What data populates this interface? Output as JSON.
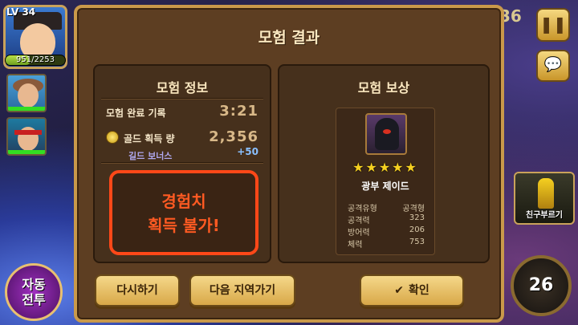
{
  "player": {
    "level": "LV 34",
    "hp_text": "951/2253",
    "hp_fraction": 0.42
  },
  "hud": {
    "auto_battle": "자동\n전투",
    "auto_battle_lines": [
      "자동",
      "전투"
    ],
    "pause_icon": "pause-icon",
    "chat_icon": "chat-icon",
    "friend_label": "친구부르기",
    "timer": "26",
    "top_counter": "36"
  },
  "dialog": {
    "title": "모험 결과",
    "info": {
      "title": "모험 정보",
      "record_label": "모험 완료 기록",
      "record_value": "3:21",
      "gold_label": "골드 획득 량",
      "gold_value": "2,356",
      "guild_label": "길드 보너스",
      "guild_value": "+50",
      "no_exp_lines": [
        "경험치",
        "획득 불가!"
      ]
    },
    "reward": {
      "title": "모험 보상",
      "stars": "★★★★★",
      "hero_name": "광부 제이드",
      "stats": [
        {
          "k": "공격유형",
          "v": "공격형"
        },
        {
          "k": "공격력",
          "v": "323"
        },
        {
          "k": "방어력",
          "v": "206"
        },
        {
          "k": "체력",
          "v": "753"
        }
      ]
    },
    "buttons": {
      "retry": "다시하기",
      "next_area": "다음 지역가기",
      "confirm": "확인"
    }
  },
  "colors": {
    "panel_bg": "#46301c",
    "dialog_bg": "#5d3e22",
    "warning": "#ff4818",
    "button": "#e0b058"
  }
}
